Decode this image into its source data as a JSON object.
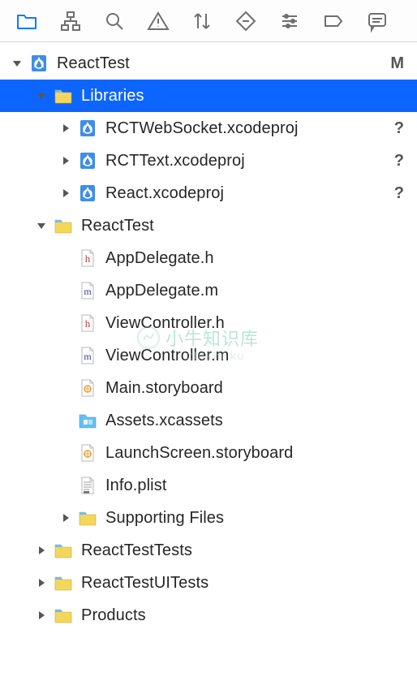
{
  "toolbar": {
    "active_index": 0,
    "icons": [
      "folder",
      "hierarchy",
      "search",
      "warning",
      "arrows",
      "diamond",
      "controls",
      "tag",
      "comment"
    ]
  },
  "tree": {
    "items": [
      {
        "depth": 0,
        "disclosure": "down",
        "icon": "xcodeproj",
        "label": "ReactTest",
        "status": "M",
        "selected": false
      },
      {
        "depth": 1,
        "disclosure": "down",
        "icon": "folder",
        "label": "Libraries",
        "status": "",
        "selected": true
      },
      {
        "depth": 2,
        "disclosure": "right",
        "icon": "xcodeproj",
        "label": "RCTWebSocket.xcodeproj",
        "status": "?",
        "selected": false
      },
      {
        "depth": 2,
        "disclosure": "right",
        "icon": "xcodeproj",
        "label": "RCTText.xcodeproj",
        "status": "?",
        "selected": false
      },
      {
        "depth": 2,
        "disclosure": "right",
        "icon": "xcodeproj",
        "label": "React.xcodeproj",
        "status": "?",
        "selected": false
      },
      {
        "depth": 1,
        "disclosure": "down",
        "icon": "folder",
        "label": "ReactTest",
        "status": "",
        "selected": false
      },
      {
        "depth": 2,
        "disclosure": "none",
        "icon": "hfile",
        "label": "AppDelegate.h",
        "status": "",
        "selected": false
      },
      {
        "depth": 2,
        "disclosure": "none",
        "icon": "mfile",
        "label": "AppDelegate.m",
        "status": "",
        "selected": false
      },
      {
        "depth": 2,
        "disclosure": "none",
        "icon": "hfile",
        "label": "ViewController.h",
        "status": "",
        "selected": false
      },
      {
        "depth": 2,
        "disclosure": "none",
        "icon": "mfile",
        "label": "ViewController.m",
        "status": "",
        "selected": false
      },
      {
        "depth": 2,
        "disclosure": "none",
        "icon": "storyboard",
        "label": "Main.storyboard",
        "status": "",
        "selected": false
      },
      {
        "depth": 2,
        "disclosure": "none",
        "icon": "xcassets",
        "label": "Assets.xcassets",
        "status": "",
        "selected": false
      },
      {
        "depth": 2,
        "disclosure": "none",
        "icon": "storyboard",
        "label": "LaunchScreen.storyboard",
        "status": "",
        "selected": false
      },
      {
        "depth": 2,
        "disclosure": "none",
        "icon": "plist",
        "label": "Info.plist",
        "status": "",
        "selected": false
      },
      {
        "depth": 2,
        "disclosure": "right",
        "icon": "folder",
        "label": "Supporting Files",
        "status": "",
        "selected": false
      },
      {
        "depth": 1,
        "disclosure": "right",
        "icon": "folder",
        "label": "ReactTestTests",
        "status": "",
        "selected": false
      },
      {
        "depth": 1,
        "disclosure": "right",
        "icon": "folder",
        "label": "ReactTestUITests",
        "status": "",
        "selected": false
      },
      {
        "depth": 1,
        "disclosure": "right",
        "icon": "folder",
        "label": "Products",
        "status": "",
        "selected": false
      }
    ]
  },
  "watermark": {
    "text": "小牛知识库",
    "sub": "zhishi ku"
  },
  "colors": {
    "selection": "#0d65ff",
    "folder_tab": "#72bcef",
    "folder_body": "#f3d65c",
    "accent_blue": "#0a7aff"
  }
}
